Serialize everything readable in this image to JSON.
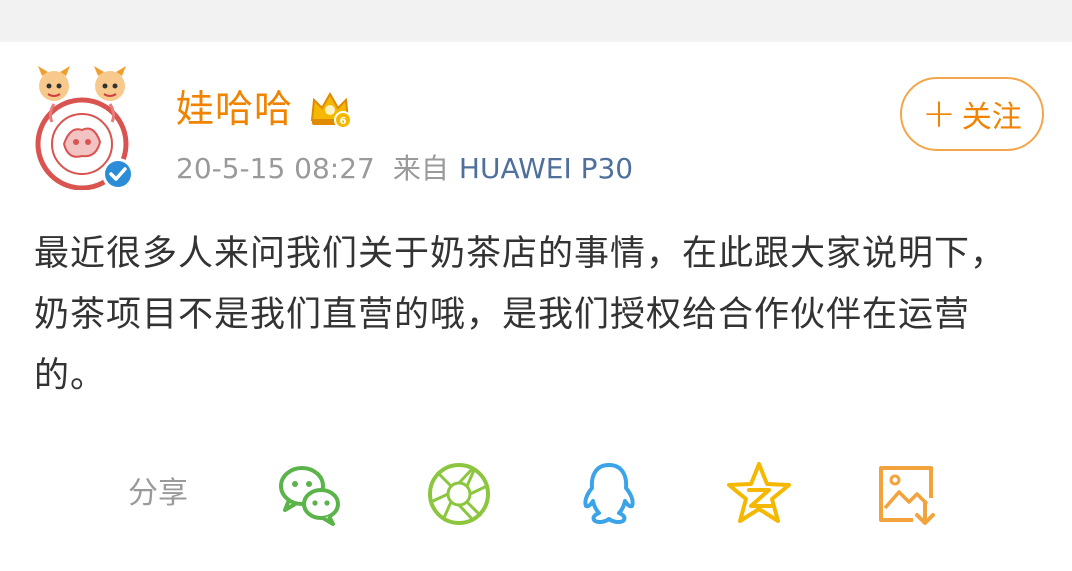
{
  "post": {
    "username": "娃哈哈",
    "timestamp": "20-5-15 08:27",
    "source_prefix": "来自",
    "device": "HUAWEI P30",
    "follow_label": "关注",
    "follow_plus": "+",
    "content": "最近很多人来问我们关于奶茶店的事情，在此跟大家说明下，奶茶项目不是我们直营的哦，是我们授权给合作伙伴在运营的。"
  },
  "share": {
    "label": "分享",
    "targets": [
      "wechat-icon",
      "moments-icon",
      "qq-icon",
      "qzone-icon",
      "save-image-icon"
    ]
  },
  "colors": {
    "accent": "#f08300",
    "device_link": "#50709c",
    "meta_text": "#9a9a9a",
    "wechat_green": "#5ab44a",
    "moments_green": "#8cc63f",
    "qq_blue": "#3ba3e8",
    "qzone_yellow": "#f5b800",
    "save_orange": "#f2a33c",
    "verified_blue": "#2b8cd8"
  }
}
